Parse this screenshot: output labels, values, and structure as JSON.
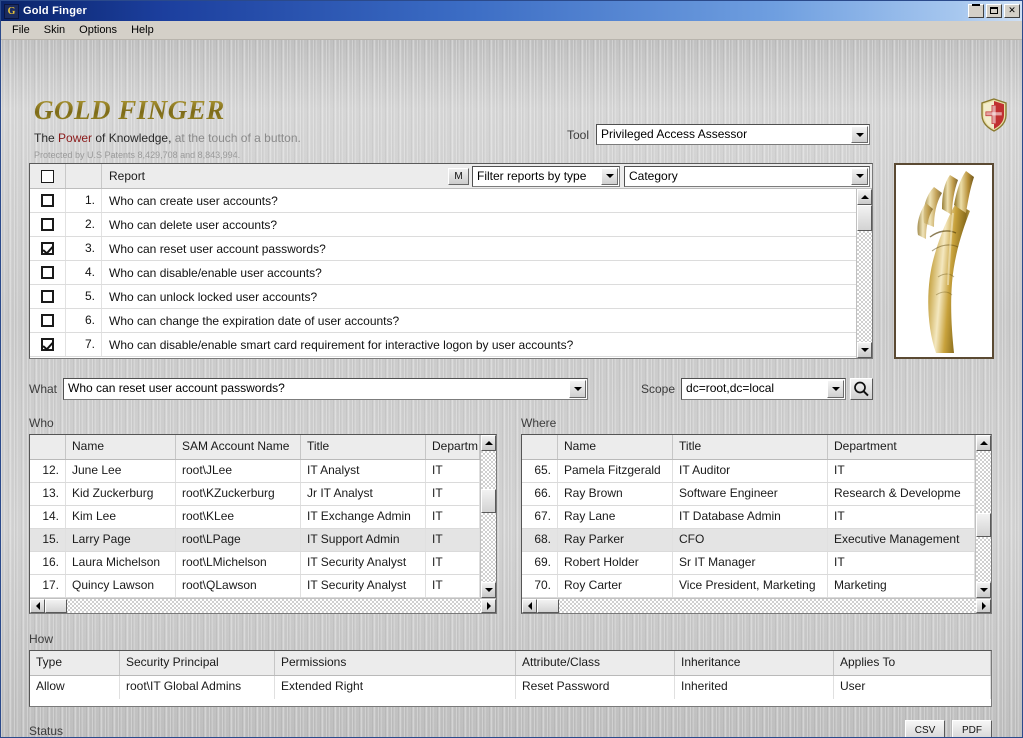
{
  "window": {
    "title": "Gold Finger",
    "app_icon": "gold-finger-icon",
    "minimize_label": "",
    "maximize_label": "",
    "close_label": "✕"
  },
  "menu": {
    "items": [
      "File",
      "Skin",
      "Options",
      "Help"
    ]
  },
  "branding": {
    "logo_title": "GOLD FINGER",
    "tagline_prefix": "The ",
    "tagline_power": "Power",
    "tagline_mid": " of Knowledge,",
    "tagline_rest": " at the touch of a button.",
    "patent_line": "Protected by U.S Patents 8,429,708 and 8,843,994.",
    "shield_icon": "security-shield-icon",
    "hand_image": "golden-hand-image"
  },
  "tool": {
    "label": "Tool",
    "value": "Privileged Access Assessor"
  },
  "report_list": {
    "header_report": "Report",
    "filter_m_button": "M",
    "filter_type_value": "Filter reports by type",
    "category_value": "Category",
    "rows": [
      {
        "num": "1.",
        "checked": false,
        "text": "Who can create user accounts?"
      },
      {
        "num": "2.",
        "checked": false,
        "text": "Who can delete user accounts?"
      },
      {
        "num": "3.",
        "checked": true,
        "text": "Who can reset user account passwords?"
      },
      {
        "num": "4.",
        "checked": false,
        "text": "Who can disable/enable user accounts?"
      },
      {
        "num": "5.",
        "checked": false,
        "text": "Who can unlock locked user accounts?"
      },
      {
        "num": "6.",
        "checked": false,
        "text": "Who can change the expiration date of user accounts?"
      },
      {
        "num": "7.",
        "checked": true,
        "text": "Who can disable/enable smart card requirement for interactive logon by user accounts?"
      }
    ]
  },
  "query": {
    "what_label": "What",
    "what_value": "Who can reset user account passwords?",
    "scope_label": "Scope",
    "scope_value": "dc=root,dc=local",
    "search_icon": "magnifier-icon"
  },
  "who": {
    "label": "Who",
    "headers": [
      "",
      "Name",
      "SAM Account Name",
      "Title",
      "Departm"
    ],
    "rows": [
      {
        "num": "12.",
        "name": "June Lee",
        "sam": "root\\JLee",
        "title": "IT Analyst",
        "dept": "IT",
        "selected": false
      },
      {
        "num": "13.",
        "name": "Kid Zuckerburg",
        "sam": "root\\KZuckerburg",
        "title": "Jr IT Analyst",
        "dept": "IT",
        "selected": false
      },
      {
        "num": "14.",
        "name": "Kim Lee",
        "sam": "root\\KLee",
        "title": "IT Exchange Admin",
        "dept": "IT",
        "selected": false
      },
      {
        "num": "15.",
        "name": "Larry Page",
        "sam": "root\\LPage",
        "title": "IT Support Admin",
        "dept": "IT",
        "selected": true
      },
      {
        "num": "16.",
        "name": "Laura Michelson",
        "sam": "root\\LMichelson",
        "title": "IT Security Analyst",
        "dept": "IT",
        "selected": false
      },
      {
        "num": "17.",
        "name": "Quincy Lawson",
        "sam": "root\\QLawson",
        "title": "IT Security Analyst",
        "dept": "IT",
        "selected": false
      }
    ]
  },
  "where": {
    "label": "Where",
    "headers": [
      "",
      "Name",
      "Title",
      "Department"
    ],
    "rows": [
      {
        "num": "65.",
        "name": "Pamela Fitzgerald",
        "title": "IT Auditor",
        "dept": "IT",
        "selected": false
      },
      {
        "num": "66.",
        "name": "Ray Brown",
        "title": "Software Engineer",
        "dept": "Research & Developme",
        "selected": false
      },
      {
        "num": "67.",
        "name": "Ray Lane",
        "title": "IT Database Admin",
        "dept": "IT",
        "selected": false
      },
      {
        "num": "68.",
        "name": "Ray Parker",
        "title": "CFO",
        "dept": "Executive Management",
        "selected": true
      },
      {
        "num": "69.",
        "name": "Robert Holder",
        "title": "Sr IT Manager",
        "dept": "IT",
        "selected": false
      },
      {
        "num": "70.",
        "name": "Roy Carter",
        "title": "Vice President, Marketing",
        "dept": "Marketing",
        "selected": false
      }
    ]
  },
  "how": {
    "label": "How",
    "headers": [
      "Type",
      "Security Principal",
      "Permissions",
      "Attribute/Class",
      "Inheritance",
      "Applies To"
    ],
    "rows": [
      {
        "type": "Allow",
        "principal": "root\\IT Global Admins",
        "permissions": "Extended Right",
        "attribute": "Reset Password",
        "inheritance": "Inherited",
        "applies_to": "User"
      }
    ]
  },
  "status": {
    "label": "Status",
    "text": "",
    "csv_button": "CSV",
    "pdf_button": "PDF"
  },
  "colors": {
    "title_bar_start": "#0a246a",
    "title_bar_end": "#cfe0f5",
    "logo_gold": "#8a7a22",
    "accent_red": "#8b1a1a",
    "selection_gray": "#e4e4e4"
  }
}
